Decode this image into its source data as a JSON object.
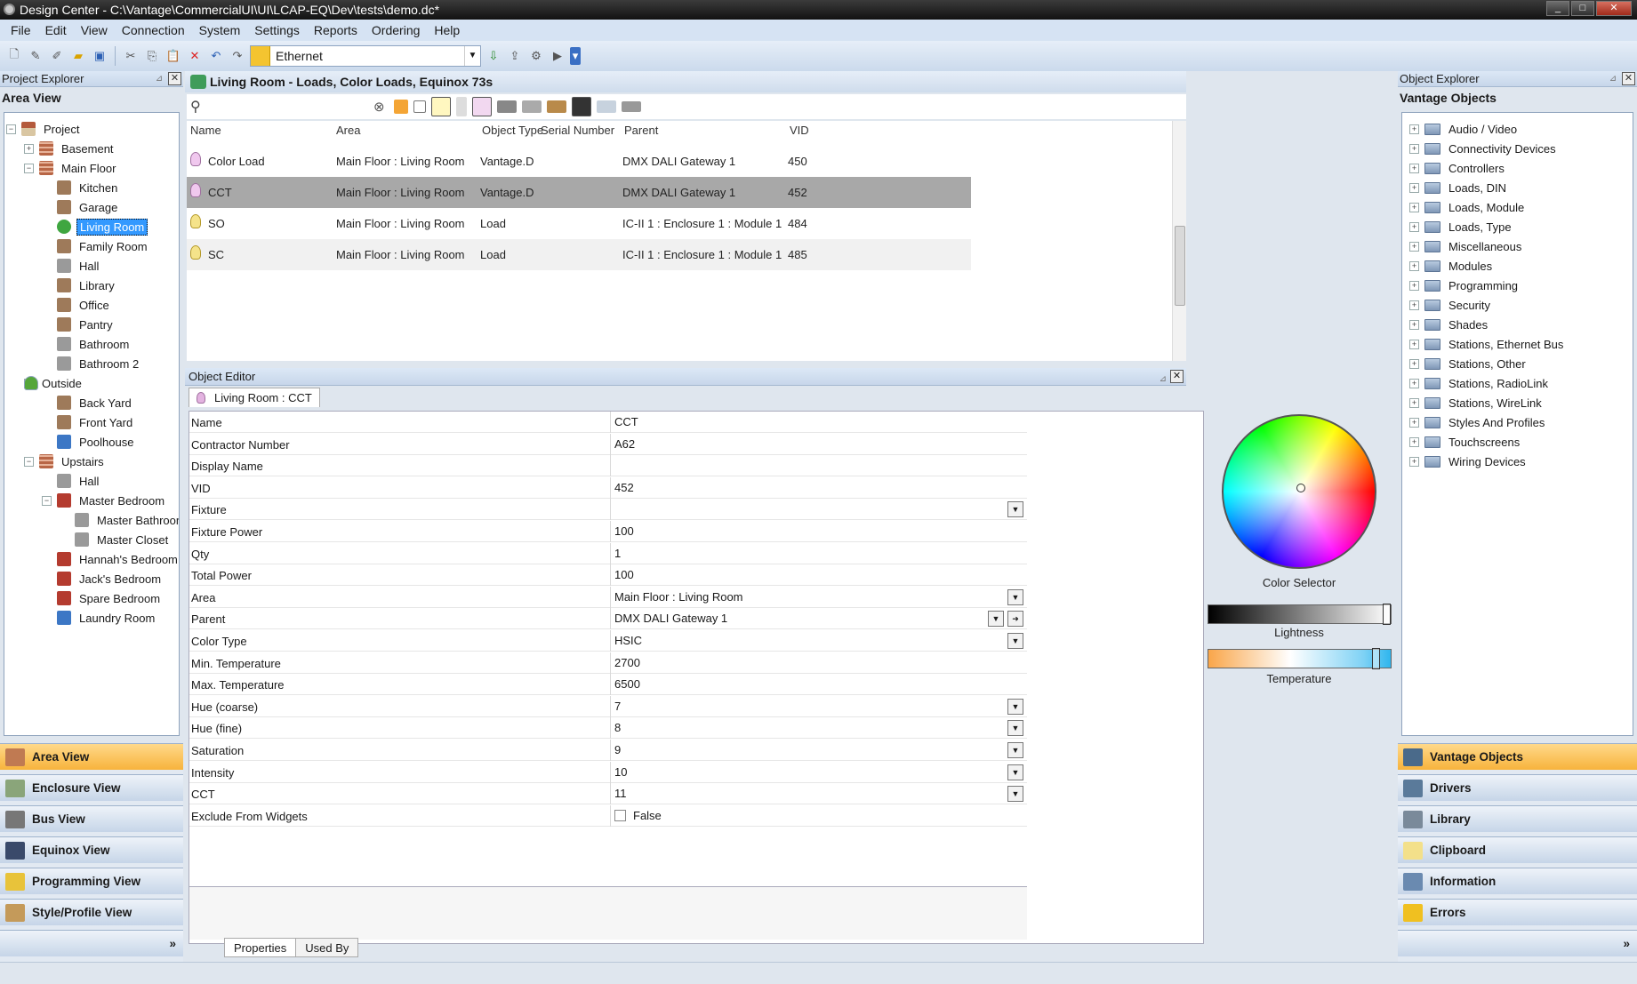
{
  "window": {
    "title": "Design Center - C:\\Vantage\\CommercialUI\\UI\\LCAP-EQ\\Dev\\tests\\demo.dc*",
    "min": "_",
    "max": "□",
    "close": "✕"
  },
  "menu": [
    "File",
    "Edit",
    "View",
    "Connection",
    "System",
    "Settings",
    "Reports",
    "Ordering",
    "Help"
  ],
  "toolbar": {
    "connection_value": "Ethernet"
  },
  "project_explorer": {
    "title": "Project Explorer",
    "subtitle": "Area View",
    "tree": [
      {
        "label": "Project",
        "icon": "house-icon",
        "level": 0,
        "expander": "−"
      },
      {
        "label": "Basement",
        "icon": "floor-icon",
        "level": 1,
        "expander": "+"
      },
      {
        "label": "Main Floor",
        "icon": "floor-icon",
        "level": 1,
        "expander": "−"
      },
      {
        "label": "Kitchen",
        "icon": "kitchen-icon",
        "level": 2
      },
      {
        "label": "Garage",
        "icon": "garage-icon",
        "level": 2
      },
      {
        "label": "Living Room",
        "icon": "living-room-icon",
        "level": 2,
        "selected": true
      },
      {
        "label": "Family Room",
        "icon": "family-room-icon",
        "level": 2
      },
      {
        "label": "Hall",
        "icon": "hall-icon",
        "level": 2
      },
      {
        "label": "Library",
        "icon": "library-icon",
        "level": 2
      },
      {
        "label": "Office",
        "icon": "office-icon",
        "level": 2
      },
      {
        "label": "Pantry",
        "icon": "pantry-icon",
        "level": 2
      },
      {
        "label": "Bathroom",
        "icon": "bathroom-icon",
        "level": 2
      },
      {
        "label": "Bathroom 2",
        "icon": "bathroom-icon",
        "level": 2
      },
      {
        "label": "Outside",
        "icon": "tree-icon",
        "level": 1,
        "expander": "−"
      },
      {
        "label": "Back Yard",
        "icon": "yard-icon",
        "level": 2
      },
      {
        "label": "Front Yard",
        "icon": "yard-icon",
        "level": 2
      },
      {
        "label": "Poolhouse",
        "icon": "poolhouse-icon",
        "level": 2
      },
      {
        "label": "Upstairs",
        "icon": "floor-icon",
        "level": 1,
        "expander": "−"
      },
      {
        "label": "Hall",
        "icon": "hall-icon",
        "level": 2
      },
      {
        "label": "Master Bedroom",
        "icon": "bedroom-icon",
        "level": 2,
        "expander": "−"
      },
      {
        "label": "Master Bathroom",
        "icon": "bathroom-icon",
        "level": 3
      },
      {
        "label": "Master Closet",
        "icon": "closet-icon",
        "level": 3
      },
      {
        "label": "Hannah's Bedroom",
        "icon": "bedroom-icon",
        "level": 2
      },
      {
        "label": "Jack's Bedroom",
        "icon": "bedroom-icon",
        "level": 2
      },
      {
        "label": "Spare Bedroom",
        "icon": "bedroom-icon",
        "level": 2
      },
      {
        "label": "Laundry Room",
        "icon": "laundry-icon",
        "level": 2
      }
    ],
    "views": [
      {
        "label": "Area View",
        "active": true
      },
      {
        "label": "Enclosure View"
      },
      {
        "label": "Bus View"
      },
      {
        "label": "Equinox View"
      },
      {
        "label": "Programming View"
      },
      {
        "label": "Style/Profile View"
      }
    ]
  },
  "center": {
    "title": "Living Room - Loads, Color Loads, Equinox 73s",
    "columns": [
      "Name",
      "Area",
      "Object Type",
      "Serial Number",
      "Parent",
      "VID"
    ],
    "rows": [
      {
        "name": "Color Load",
        "area": "Main Floor : Living Room",
        "type": "Vantage.D",
        "serial": "",
        "parent": "DMX DALI Gateway 1",
        "vid": "450"
      },
      {
        "name": "CCT",
        "area": "Main Floor : Living Room",
        "type": "Vantage.D",
        "serial": "",
        "parent": "DMX DALI Gateway 1",
        "vid": "452"
      },
      {
        "name": "SO",
        "area": "Main Floor : Living Room",
        "type": "Load",
        "serial": "",
        "parent": "IC-II 1 : Enclosure 1 : Module 1",
        "vid": "484"
      },
      {
        "name": "SC",
        "area": "Main Floor : Living Room",
        "type": "Load",
        "serial": "",
        "parent": "IC-II 1 : Enclosure 1 : Module 1",
        "vid": "485"
      }
    ]
  },
  "object_editor": {
    "title": "Object Editor",
    "tab": "Living Room : CCT",
    "properties": [
      {
        "key": "Name",
        "value": "CCT"
      },
      {
        "key": "Contractor Number",
        "value": "A62"
      },
      {
        "key": "Display Name",
        "value": ""
      },
      {
        "key": "VID",
        "value": "452"
      },
      {
        "key": "Fixture",
        "value": "",
        "dropdown": true
      },
      {
        "key": "Fixture Power",
        "value": "100"
      },
      {
        "key": "Qty",
        "value": "1"
      },
      {
        "key": "Total Power",
        "value": "100"
      },
      {
        "key": "Area",
        "value": "Main Floor : Living Room",
        "dropdown": true
      },
      {
        "key": "Parent",
        "value": "DMX DALI Gateway 1",
        "dropdown": true
      },
      {
        "key": "Color Type",
        "value": "HSIC",
        "dropdown": true
      },
      {
        "key": "Min. Temperature",
        "value": "2700"
      },
      {
        "key": "Max. Temperature",
        "value": "6500"
      },
      {
        "key": "Hue (coarse)",
        "value": "7",
        "dropdown": true
      },
      {
        "key": "Hue (fine)",
        "value": "8",
        "dropdown": true
      },
      {
        "key": "Saturation",
        "value": "9",
        "dropdown": true
      },
      {
        "key": "Intensity",
        "value": "10",
        "dropdown": true
      },
      {
        "key": "CCT",
        "value": "11",
        "dropdown": true
      },
      {
        "key": "Exclude From Widgets",
        "value": "False",
        "checkbox": true
      }
    ],
    "color_labels": {
      "selector": "Color Selector",
      "lightness": "Lightness",
      "temperature": "Temperature"
    },
    "bottom_tabs": [
      "Properties",
      "Used By"
    ]
  },
  "object_explorer": {
    "title": "Object Explorer",
    "subtitle": "Vantage Objects",
    "folders": [
      "Audio / Video",
      "Connectivity Devices",
      "Controllers",
      "Loads, DIN",
      "Loads, Module",
      "Loads, Type",
      "Miscellaneous",
      "Modules",
      "Programming",
      "Security",
      "Shades",
      "Stations, Ethernet Bus",
      "Stations, Other",
      "Stations, RadioLink",
      "Stations, WireLink",
      "Styles And Profiles",
      "Touchscreens",
      "Wiring Devices"
    ],
    "views": [
      {
        "label": "Vantage Objects",
        "active": true
      },
      {
        "label": "Drivers"
      },
      {
        "label": "Library"
      },
      {
        "label": "Clipboard"
      },
      {
        "label": "Information"
      },
      {
        "label": "Errors"
      }
    ]
  }
}
